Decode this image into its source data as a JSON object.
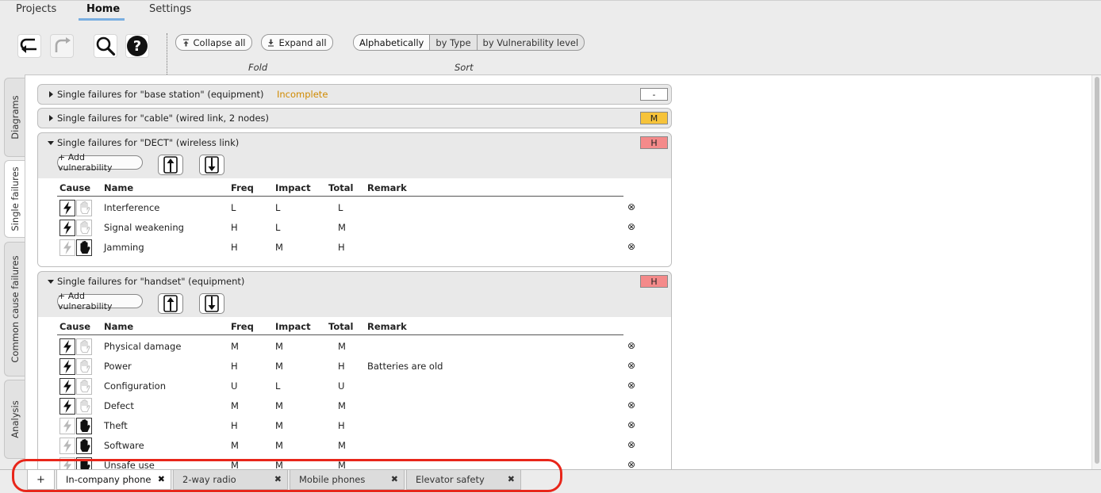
{
  "menu": {
    "tabs": [
      "Projects",
      "Home",
      "Settings"
    ],
    "active": "Home"
  },
  "toolbar": {
    "collapse_label": "Collapse all",
    "expand_label": "Expand all",
    "fold_caption": "Fold",
    "sort_caption": "Sort",
    "sort_options": [
      "Alphabetically",
      "by Type",
      "by Vulnerability level"
    ],
    "sort_selected": "Alphabetically"
  },
  "side_tabs": [
    "Diagrams",
    "Single failures",
    "Common cause failures",
    "Analysis"
  ],
  "side_active": "Single failures",
  "colors": {
    "incomplete": "#d08a00",
    "level_M": "#f6c33a",
    "level_H": "#f48a8a",
    "highlight": "#e8261a"
  },
  "headers": {
    "cause": "Cause",
    "name": "Name",
    "freq": "Freq",
    "impact": "Impact",
    "total": "Total",
    "remark": "Remark"
  },
  "add_vuln_label": "+ Add vulnerability",
  "panels": [
    {
      "title": "Single failures for \"base station\" (equipment)",
      "status": "Incomplete",
      "level": "-",
      "expanded": false
    },
    {
      "title": "Single failures for \"cable\" (wired link, 2 nodes)",
      "level": "M",
      "expanded": false
    },
    {
      "title": "Single failures for \"DECT\" (wireless link)",
      "level": "H",
      "expanded": true,
      "rows": [
        {
          "cause": "natural",
          "name": "Interference",
          "freq": "L",
          "impact": "L",
          "total": "L",
          "remark": ""
        },
        {
          "cause": "natural",
          "name": "Signal weakening",
          "freq": "H",
          "impact": "L",
          "total": "M",
          "remark": ""
        },
        {
          "cause": "human",
          "name": "Jamming",
          "freq": "H",
          "impact": "M",
          "total": "H",
          "remark": ""
        }
      ]
    },
    {
      "title": "Single failures for \"handset\" (equipment)",
      "level": "H",
      "expanded": true,
      "rows": [
        {
          "cause": "natural",
          "name": "Physical damage",
          "freq": "M",
          "impact": "M",
          "total": "M",
          "remark": ""
        },
        {
          "cause": "natural",
          "name": "Power",
          "freq": "H",
          "impact": "M",
          "total": "H",
          "remark": "Batteries are old"
        },
        {
          "cause": "natural",
          "name": "Configuration",
          "freq": "U",
          "impact": "L",
          "total": "U",
          "remark": ""
        },
        {
          "cause": "natural",
          "name": "Defect",
          "freq": "M",
          "impact": "M",
          "total": "M",
          "remark": ""
        },
        {
          "cause": "human",
          "name": "Theft",
          "freq": "H",
          "impact": "M",
          "total": "H",
          "remark": ""
        },
        {
          "cause": "human",
          "name": "Software",
          "freq": "M",
          "impact": "M",
          "total": "M",
          "remark": ""
        },
        {
          "cause": "human",
          "name": "Unsafe use",
          "freq": "M",
          "impact": "M",
          "total": "M",
          "remark": ""
        }
      ]
    }
  ],
  "bottom_tabs": [
    {
      "label": "In-company phone",
      "active": true
    },
    {
      "label": "2-way radio",
      "active": false
    },
    {
      "label": "Mobile phones",
      "active": false
    },
    {
      "label": "Elevator safety",
      "active": false
    }
  ],
  "add_tab_label": "+"
}
